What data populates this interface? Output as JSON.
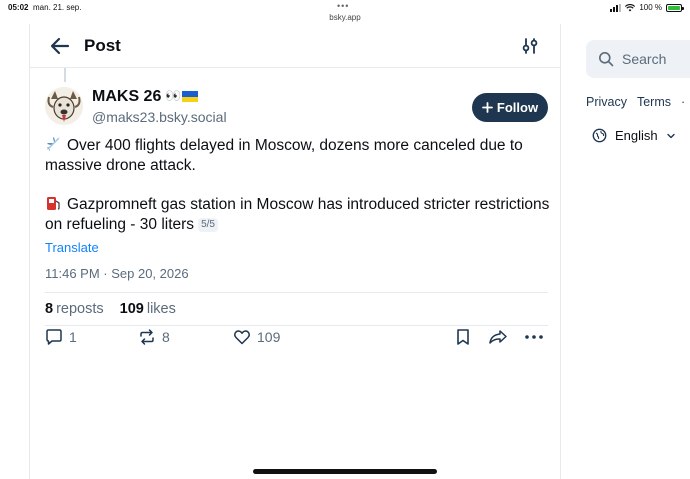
{
  "status_bar": {
    "time": "05:02",
    "date": "man. 21. sep.",
    "url": "bsky.app",
    "battery_text": "100 %",
    "battery_level": 1.0
  },
  "header": {
    "title": "Post"
  },
  "post": {
    "author_name": "MAKS 26",
    "author_emoji": "👀",
    "handle": "@maks23.bsky.social",
    "follow_label": "Follow",
    "paragraph1": "Over 400 flights delayed in Moscow, dozens more canceled due to massive drone attack.",
    "paragraph2": "Gazpromneft gas station in Moscow has introduced stricter restrictions on refueling - 30 liters",
    "thread_count": "5/5",
    "translate_label": "Translate",
    "timestamp": "11:46 PM · Sep 20, 2026",
    "reposts_count": "8",
    "reposts_label": "reposts",
    "likes_count": "109",
    "likes_label": "likes"
  },
  "actions": {
    "reply_count": "1",
    "repost_count": "8",
    "like_count": "109"
  },
  "sidebar": {
    "search_placeholder": "Search",
    "links": [
      "Privacy",
      "Terms",
      "·"
    ],
    "language": "English"
  },
  "colors": {
    "follow_bg": "#1f3651",
    "link_blue": "#1083fe",
    "muted_text": "#5b6b7c",
    "border": "#e6e9ee"
  }
}
